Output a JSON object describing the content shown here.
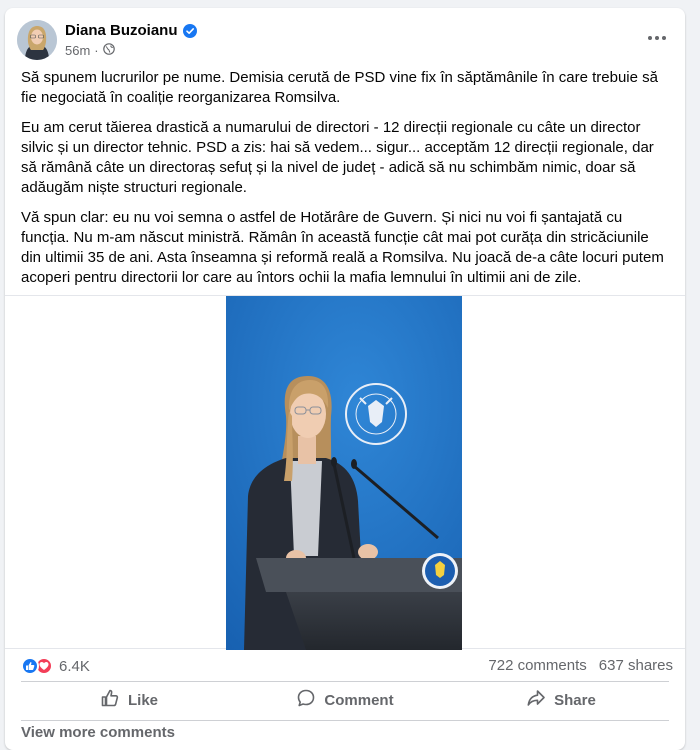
{
  "post": {
    "author": "Diana Buzoianu",
    "time": "56m",
    "separator": "·",
    "paragraphs": [
      "Să spunem lucrurilor pe nume. Demisia cerută de PSD vine fix în săptămânile în care trebuie să fie negociată în coaliție reorganizarea Romsilva.",
      "Eu am cerut tăierea drastică a numarului de directori - 12 direcții regionale cu câte un director silvic și un director tehnic. PSD a zis: hai să vedem... sigur... acceptăm 12 direcții regionale, dar să rămână câte un directoraș sefuț și la nivel de județ - adică să nu schimbăm nimic, doar să adăugăm niște structuri regionale.",
      "Vă spun clar: eu nu voi semna o astfel de Hotărâre de Guvern. Și nici nu voi fi șantajată cu funcția. Nu m-am născut ministră. Rămân în această funcție cât mai pot curăța din stricăciunile din ultimii 35 de ani. Asta înseamna și reformă reală a Romsilva. Nu joacă de-a câte locuri putem acoperi pentru directorii lor care au întors ochii la mafia lemnului în ultimii ani de zile."
    ],
    "photo": {
      "seal_text": "GUVERNUL ROMÂNIEI",
      "background_color": "#1e74c8"
    }
  },
  "stats": {
    "reaction_count": "6.4K",
    "comments": "722 comments",
    "shares": "637 shares"
  },
  "actions": {
    "like": "Like",
    "comment": "Comment",
    "share": "Share"
  },
  "footer": {
    "view_more": "View more comments"
  },
  "colors": {
    "like_blue": "#1877f2",
    "love_red": "#f33e58",
    "secondary_text": "#65676b"
  }
}
